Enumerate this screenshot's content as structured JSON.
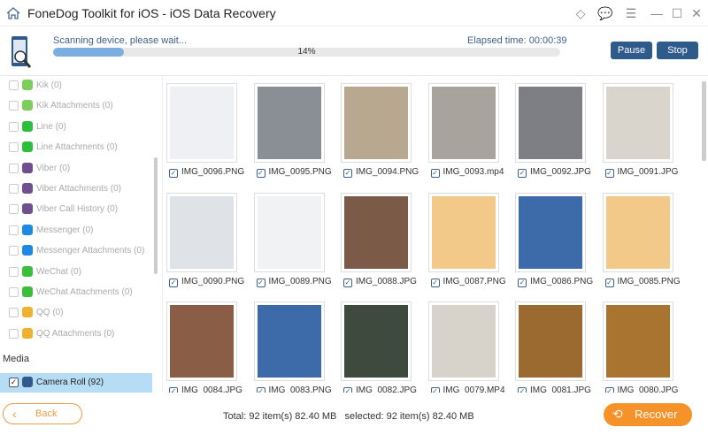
{
  "window": {
    "title": "FoneDog Toolkit for iOS - iOS Data Recovery"
  },
  "scan": {
    "status": "Scanning device, please wait...",
    "elapsed": "Elapsed time: 00:00:39",
    "progress_percent": 14,
    "progress_label": "14%",
    "pause": "Pause",
    "stop": "Stop"
  },
  "sidebar": {
    "items": [
      {
        "label": "Kik (0)",
        "icon": "kik",
        "color": "#7ccf5a"
      },
      {
        "label": "Kik Attachments (0)",
        "icon": "kik",
        "color": "#7ccf5a"
      },
      {
        "label": "Line (0)",
        "icon": "line",
        "color": "#2bbf3b"
      },
      {
        "label": "Line Attachments (0)",
        "icon": "line",
        "color": "#2bbf3b"
      },
      {
        "label": "Viber (0)",
        "icon": "viber",
        "color": "#6f4f8f"
      },
      {
        "label": "Viber Attachments (0)",
        "icon": "viber",
        "color": "#6f4f8f"
      },
      {
        "label": "Viber Call History (0)",
        "icon": "viber",
        "color": "#6f4f8f"
      },
      {
        "label": "Messenger (0)",
        "icon": "messenger",
        "color": "#1e88e5"
      },
      {
        "label": "Messenger Attachments (0)",
        "icon": "messenger",
        "color": "#1e88e5"
      },
      {
        "label": "WeChat (0)",
        "icon": "wechat",
        "color": "#3bbf3b"
      },
      {
        "label": "WeChat Attachments (0)",
        "icon": "wechat",
        "color": "#3bbf3b"
      },
      {
        "label": "QQ (0)",
        "icon": "qq",
        "color": "#f0b030"
      },
      {
        "label": "QQ Attachments (0)",
        "icon": "qq",
        "color": "#f0b030"
      }
    ],
    "media_heading": "Media",
    "camera_roll": "Camera Roll (92)"
  },
  "files": [
    {
      "name": "IMG_0096.PNG",
      "color": "#eef0f3"
    },
    {
      "name": "IMG_0095.PNG",
      "color": "#8a8f96"
    },
    {
      "name": "IMG_0094.PNG",
      "color": "#b9a890"
    },
    {
      "name": "IMG_0093.mp4",
      "color": "#a8a39c"
    },
    {
      "name": "IMG_0092.JPG",
      "color": "#7d7f84"
    },
    {
      "name": "IMG_0091.JPG",
      "color": "#d9d5cd"
    },
    {
      "name": "IMG_0090.PNG",
      "color": "#dfe3e8"
    },
    {
      "name": "IMG_0089.PNG",
      "color": "#f1f2f4"
    },
    {
      "name": "IMG_0088.JPG",
      "color": "#7b5a48"
    },
    {
      "name": "IMG_0087.PNG",
      "color": "#f3c98a"
    },
    {
      "name": "IMG_0086.PNG",
      "color": "#3d6aa8"
    },
    {
      "name": "IMG_0085.PNG",
      "color": "#f3c98a"
    },
    {
      "name": "IMG_0084.JPG",
      "color": "#8a5e46"
    },
    {
      "name": "IMG_0083.PNG",
      "color": "#3d6aa8"
    },
    {
      "name": "IMG_0082.JPG",
      "color": "#3e4a3e"
    },
    {
      "name": "IMG_0079.MP4",
      "color": "#d7d2ca"
    },
    {
      "name": "IMG_0081.JPG",
      "color": "#9a6a30"
    },
    {
      "name": "IMG_0080.JPG",
      "color": "#a8742f"
    }
  ],
  "footer": {
    "back": "Back",
    "total": "Total: 92 item(s) 82.40 MB   selected: 92 item(s) 82.40 MB",
    "recover": "Recover"
  },
  "colors": {
    "accent": "#2f5b8c",
    "orange": "#f5922a",
    "progress": "#7aaee0",
    "selected": "#b7dcf6"
  }
}
